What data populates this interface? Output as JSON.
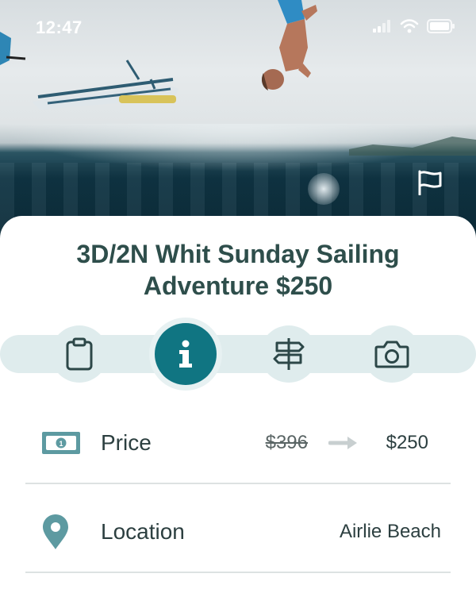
{
  "status_bar": {
    "time": "12:47"
  },
  "icons": {
    "flag": "flag-icon",
    "signal": "signal-icon",
    "wifi": "wifi-icon",
    "battery": "battery-icon"
  },
  "trip": {
    "title_line1": "3D/2N Whit Sunday Sailing",
    "title_line2": "Adventure $250"
  },
  "tabs": [
    {
      "icon": "clipboard-icon",
      "active": false
    },
    {
      "icon": "info-icon",
      "active": true
    },
    {
      "icon": "signpost-icon",
      "active": false
    },
    {
      "icon": "camera-icon",
      "active": false
    }
  ],
  "details": {
    "price": {
      "label": "Price",
      "old_value": "$396",
      "new_value": "$250",
      "icon": "banknote-icon"
    },
    "location": {
      "label": "Location",
      "value": "Airlie Beach",
      "icon": "location-pin-icon"
    }
  },
  "colors": {
    "accent": "#107582",
    "title": "#2e4e4b",
    "tab_background": "#dfeced",
    "icon_muted": "#5d9aa1"
  }
}
